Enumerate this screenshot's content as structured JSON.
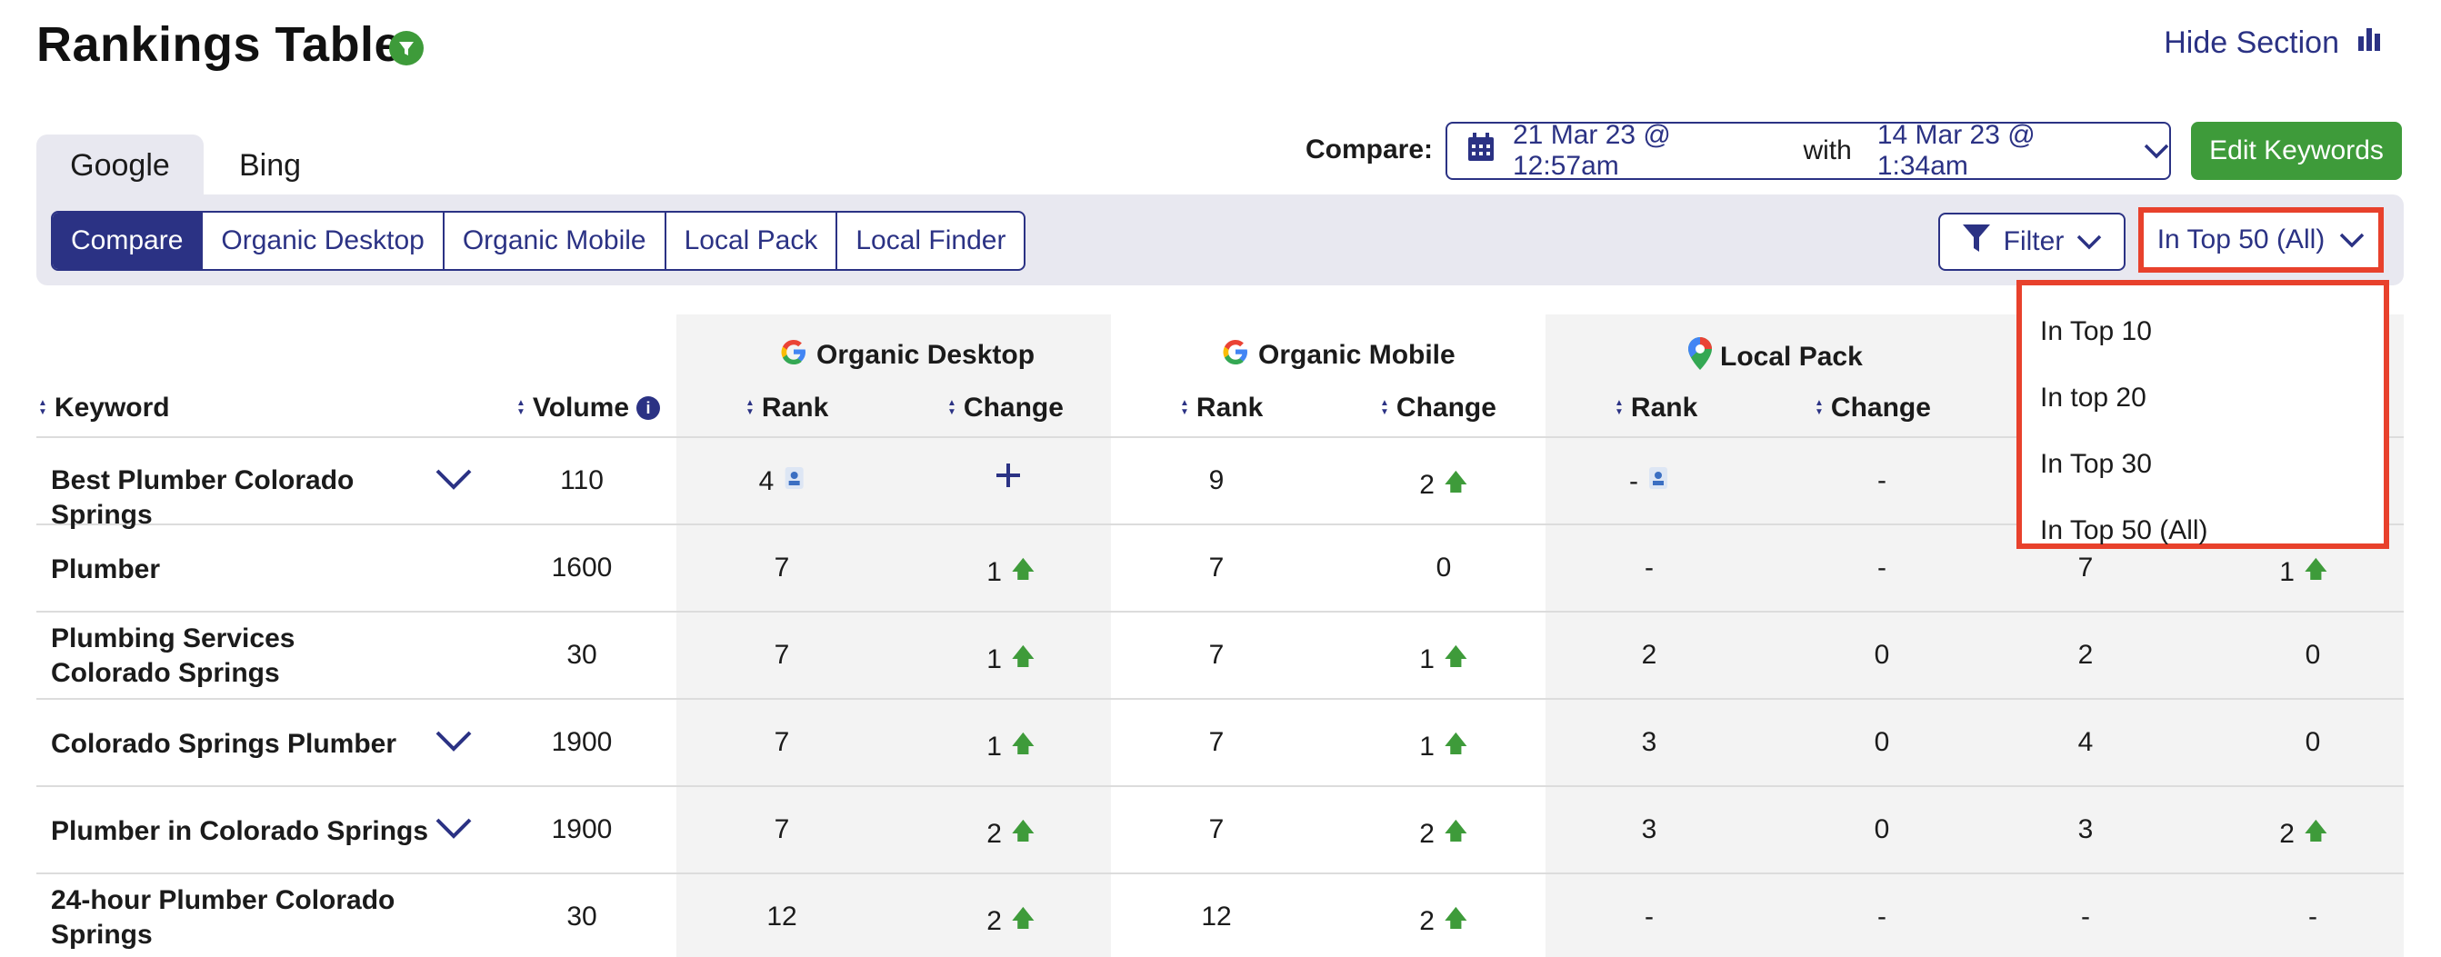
{
  "header": {
    "title": "Rankings Table",
    "hide_section": "Hide Section"
  },
  "engine_tabs": [
    {
      "label": "Google",
      "active": true
    },
    {
      "label": "Bing",
      "active": false
    }
  ],
  "compare": {
    "label": "Compare:",
    "date_from": "21 Mar 23 @ 12:57am",
    "with_word": "with",
    "date_to": "14 Mar 23 @ 1:34am"
  },
  "edit_keywords": "Edit Keywords",
  "view_buttons": [
    "Compare",
    "Organic Desktop",
    "Organic Mobile",
    "Local Pack",
    "Local Finder"
  ],
  "filter_label": "Filter",
  "top_select": {
    "selected": "In Top 50 (All)",
    "options": [
      "In Top 10",
      "In top 20",
      "In Top 30",
      "In Top 50 (All)"
    ]
  },
  "table": {
    "keyword_header": "Keyword",
    "volume_header": "Volume",
    "sections": [
      "Organic Desktop",
      "Organic Mobile",
      "Local Pack"
    ],
    "rank_header": "Rank",
    "change_header": "Change",
    "rows": [
      {
        "keyword": "Best Plumber Colorado Springs",
        "volume": "110",
        "od_rank": "4",
        "od_change": "+",
        "om_rank": "9",
        "om_change": "2",
        "lp_rank": "-",
        "lp_change": "-",
        "lf_rank": "",
        "lf_change": ""
      },
      {
        "keyword": "Plumber",
        "volume": "1600",
        "od_rank": "7",
        "od_change": "1",
        "om_rank": "7",
        "om_change": "0",
        "lp_rank": "-",
        "lp_change": "-",
        "lf_rank": "7",
        "lf_change": "1"
      },
      {
        "keyword": "Plumbing Services Colorado Springs",
        "volume": "30",
        "od_rank": "7",
        "od_change": "1",
        "om_rank": "7",
        "om_change": "1",
        "lp_rank": "2",
        "lp_change": "0",
        "lf_rank": "2",
        "lf_change": "0"
      },
      {
        "keyword": "Colorado Springs Plumber",
        "volume": "1900",
        "od_rank": "7",
        "od_change": "1",
        "om_rank": "7",
        "om_change": "1",
        "lp_rank": "3",
        "lp_change": "0",
        "lf_rank": "4",
        "lf_change": "0"
      },
      {
        "keyword": "Plumber in Colorado Springs",
        "volume": "1900",
        "od_rank": "7",
        "od_change": "2",
        "om_rank": "7",
        "om_change": "2",
        "lp_rank": "3",
        "lp_change": "0",
        "lf_rank": "3",
        "lf_change": "2"
      },
      {
        "keyword": "24-hour Plumber Colorado Springs",
        "volume": "30",
        "od_rank": "12",
        "od_change": "2",
        "om_rank": "12",
        "om_change": "2",
        "lp_rank": "-",
        "lp_change": "-",
        "lf_rank": "-",
        "lf_change": "-"
      }
    ]
  },
  "colors": {
    "accent": "#2b3284",
    "green": "#3e9b3a",
    "highlight": "#e8412c"
  },
  "icons": {
    "title_badge": "filter-icon",
    "hide_section": "bar-chart-icon",
    "date": "calendar-icon",
    "dropdown": "chevron-down-icon",
    "up": "arrow-up-icon"
  }
}
